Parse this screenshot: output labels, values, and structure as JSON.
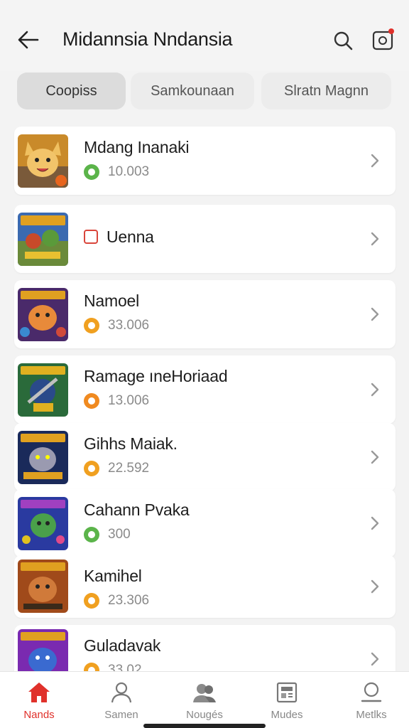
{
  "header": {
    "title": "Midannsia Nndansia",
    "back_icon": "arrow-left-icon",
    "search_icon": "search-icon",
    "notification_icon": "notification-icon",
    "accent": "#e0312b"
  },
  "tabs": [
    {
      "label": "Coopiss",
      "active": true
    },
    {
      "label": "Samkounaan",
      "active": false
    },
    {
      "label": "Slratn Magnn",
      "active": false
    }
  ],
  "list": [
    {
      "title": "Mdang Inanaki",
      "value": "10.003",
      "coin_color": "#5bb44a"
    },
    {
      "title": "Uenna",
      "value": "",
      "coin_color": "#d9453b"
    },
    {
      "title": "Namoel",
      "value": "33.006",
      "coin_color": "#f0a020"
    },
    {
      "title": "Ramage ıneHoriaad",
      "value": "13.006",
      "coin_color": "#f08a20"
    },
    {
      "title": "Gihhs Maiak.",
      "value": "22.592",
      "coin_color": "#f0a020"
    },
    {
      "title": "Cahann Pvaka",
      "value": "300",
      "coin_color": "#5bb44a"
    },
    {
      "title": "Kamihel",
      "value": "23.306",
      "coin_color": "#f0a020"
    },
    {
      "title": "Guladavak",
      "value": "33.02",
      "coin_color": "#f0a020"
    }
  ],
  "bottom_nav": [
    {
      "label": "Nands",
      "icon": "home-icon",
      "active": true
    },
    {
      "label": "Samen",
      "icon": "user-icon",
      "active": false
    },
    {
      "label": "Nougés",
      "icon": "users-icon",
      "active": false
    },
    {
      "label": "Mudes",
      "icon": "news-icon",
      "active": false
    },
    {
      "label": "Metlks",
      "icon": "profile-icon",
      "active": false
    }
  ]
}
